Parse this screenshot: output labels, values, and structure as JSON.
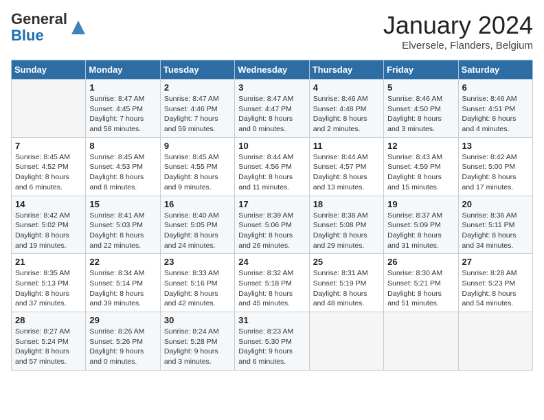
{
  "logo": {
    "text_general": "General",
    "text_blue": "Blue"
  },
  "header": {
    "month": "January 2024",
    "location": "Elversele, Flanders, Belgium"
  },
  "weekdays": [
    "Sunday",
    "Monday",
    "Tuesday",
    "Wednesday",
    "Thursday",
    "Friday",
    "Saturday"
  ],
  "weeks": [
    [
      {
        "day": "",
        "sunrise": "",
        "sunset": "",
        "daylight": ""
      },
      {
        "day": "1",
        "sunrise": "Sunrise: 8:47 AM",
        "sunset": "Sunset: 4:45 PM",
        "daylight": "Daylight: 7 hours and 58 minutes."
      },
      {
        "day": "2",
        "sunrise": "Sunrise: 8:47 AM",
        "sunset": "Sunset: 4:46 PM",
        "daylight": "Daylight: 7 hours and 59 minutes."
      },
      {
        "day": "3",
        "sunrise": "Sunrise: 8:47 AM",
        "sunset": "Sunset: 4:47 PM",
        "daylight": "Daylight: 8 hours and 0 minutes."
      },
      {
        "day": "4",
        "sunrise": "Sunrise: 8:46 AM",
        "sunset": "Sunset: 4:48 PM",
        "daylight": "Daylight: 8 hours and 2 minutes."
      },
      {
        "day": "5",
        "sunrise": "Sunrise: 8:46 AM",
        "sunset": "Sunset: 4:50 PM",
        "daylight": "Daylight: 8 hours and 3 minutes."
      },
      {
        "day": "6",
        "sunrise": "Sunrise: 8:46 AM",
        "sunset": "Sunset: 4:51 PM",
        "daylight": "Daylight: 8 hours and 4 minutes."
      }
    ],
    [
      {
        "day": "7",
        "sunrise": "Sunrise: 8:45 AM",
        "sunset": "Sunset: 4:52 PM",
        "daylight": "Daylight: 8 hours and 6 minutes."
      },
      {
        "day": "8",
        "sunrise": "Sunrise: 8:45 AM",
        "sunset": "Sunset: 4:53 PM",
        "daylight": "Daylight: 8 hours and 8 minutes."
      },
      {
        "day": "9",
        "sunrise": "Sunrise: 8:45 AM",
        "sunset": "Sunset: 4:55 PM",
        "daylight": "Daylight: 8 hours and 9 minutes."
      },
      {
        "day": "10",
        "sunrise": "Sunrise: 8:44 AM",
        "sunset": "Sunset: 4:56 PM",
        "daylight": "Daylight: 8 hours and 11 minutes."
      },
      {
        "day": "11",
        "sunrise": "Sunrise: 8:44 AM",
        "sunset": "Sunset: 4:57 PM",
        "daylight": "Daylight: 8 hours and 13 minutes."
      },
      {
        "day": "12",
        "sunrise": "Sunrise: 8:43 AM",
        "sunset": "Sunset: 4:59 PM",
        "daylight": "Daylight: 8 hours and 15 minutes."
      },
      {
        "day": "13",
        "sunrise": "Sunrise: 8:42 AM",
        "sunset": "Sunset: 5:00 PM",
        "daylight": "Daylight: 8 hours and 17 minutes."
      }
    ],
    [
      {
        "day": "14",
        "sunrise": "Sunrise: 8:42 AM",
        "sunset": "Sunset: 5:02 PM",
        "daylight": "Daylight: 8 hours and 19 minutes."
      },
      {
        "day": "15",
        "sunrise": "Sunrise: 8:41 AM",
        "sunset": "Sunset: 5:03 PM",
        "daylight": "Daylight: 8 hours and 22 minutes."
      },
      {
        "day": "16",
        "sunrise": "Sunrise: 8:40 AM",
        "sunset": "Sunset: 5:05 PM",
        "daylight": "Daylight: 8 hours and 24 minutes."
      },
      {
        "day": "17",
        "sunrise": "Sunrise: 8:39 AM",
        "sunset": "Sunset: 5:06 PM",
        "daylight": "Daylight: 8 hours and 26 minutes."
      },
      {
        "day": "18",
        "sunrise": "Sunrise: 8:38 AM",
        "sunset": "Sunset: 5:08 PM",
        "daylight": "Daylight: 8 hours and 29 minutes."
      },
      {
        "day": "19",
        "sunrise": "Sunrise: 8:37 AM",
        "sunset": "Sunset: 5:09 PM",
        "daylight": "Daylight: 8 hours and 31 minutes."
      },
      {
        "day": "20",
        "sunrise": "Sunrise: 8:36 AM",
        "sunset": "Sunset: 5:11 PM",
        "daylight": "Daylight: 8 hours and 34 minutes."
      }
    ],
    [
      {
        "day": "21",
        "sunrise": "Sunrise: 8:35 AM",
        "sunset": "Sunset: 5:13 PM",
        "daylight": "Daylight: 8 hours and 37 minutes."
      },
      {
        "day": "22",
        "sunrise": "Sunrise: 8:34 AM",
        "sunset": "Sunset: 5:14 PM",
        "daylight": "Daylight: 8 hours and 39 minutes."
      },
      {
        "day": "23",
        "sunrise": "Sunrise: 8:33 AM",
        "sunset": "Sunset: 5:16 PM",
        "daylight": "Daylight: 8 hours and 42 minutes."
      },
      {
        "day": "24",
        "sunrise": "Sunrise: 8:32 AM",
        "sunset": "Sunset: 5:18 PM",
        "daylight": "Daylight: 8 hours and 45 minutes."
      },
      {
        "day": "25",
        "sunrise": "Sunrise: 8:31 AM",
        "sunset": "Sunset: 5:19 PM",
        "daylight": "Daylight: 8 hours and 48 minutes."
      },
      {
        "day": "26",
        "sunrise": "Sunrise: 8:30 AM",
        "sunset": "Sunset: 5:21 PM",
        "daylight": "Daylight: 8 hours and 51 minutes."
      },
      {
        "day": "27",
        "sunrise": "Sunrise: 8:28 AM",
        "sunset": "Sunset: 5:23 PM",
        "daylight": "Daylight: 8 hours and 54 minutes."
      }
    ],
    [
      {
        "day": "28",
        "sunrise": "Sunrise: 8:27 AM",
        "sunset": "Sunset: 5:24 PM",
        "daylight": "Daylight: 8 hours and 57 minutes."
      },
      {
        "day": "29",
        "sunrise": "Sunrise: 8:26 AM",
        "sunset": "Sunset: 5:26 PM",
        "daylight": "Daylight: 9 hours and 0 minutes."
      },
      {
        "day": "30",
        "sunrise": "Sunrise: 8:24 AM",
        "sunset": "Sunset: 5:28 PM",
        "daylight": "Daylight: 9 hours and 3 minutes."
      },
      {
        "day": "31",
        "sunrise": "Sunrise: 8:23 AM",
        "sunset": "Sunset: 5:30 PM",
        "daylight": "Daylight: 9 hours and 6 minutes."
      },
      {
        "day": "",
        "sunrise": "",
        "sunset": "",
        "daylight": ""
      },
      {
        "day": "",
        "sunrise": "",
        "sunset": "",
        "daylight": ""
      },
      {
        "day": "",
        "sunrise": "",
        "sunset": "",
        "daylight": ""
      }
    ]
  ]
}
